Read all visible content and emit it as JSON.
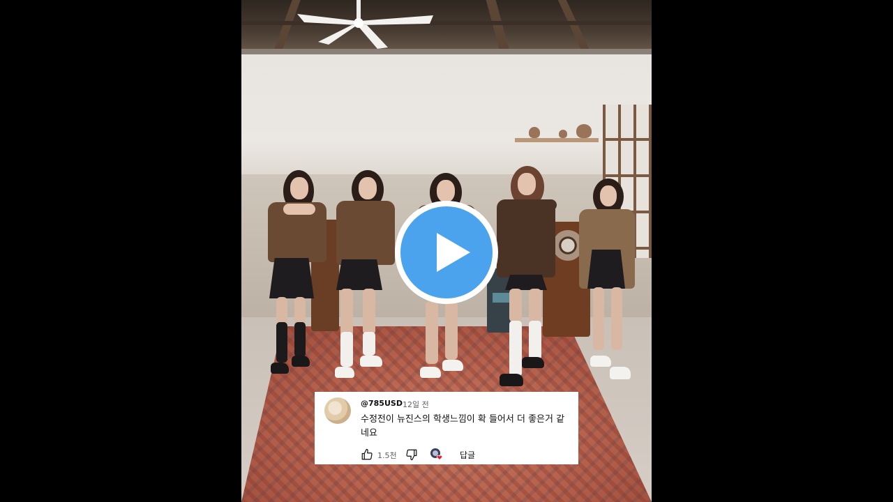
{
  "video": {
    "state": "paused",
    "controls": {
      "play_icon": "play-icon",
      "play_button_color": "#4aa3ec"
    }
  },
  "comment": {
    "author": "@785USD",
    "time": "12일 전",
    "text": "수정전이 뉴진스의 학생느낌이 확 들어서 더 좋은거 같네요",
    "likes": "1.5천",
    "reply_label": "답글",
    "icons": {
      "like": "thumbs-up-icon",
      "dislike": "thumbs-down-icon",
      "creator_heart": "creator-heart-icon"
    }
  }
}
